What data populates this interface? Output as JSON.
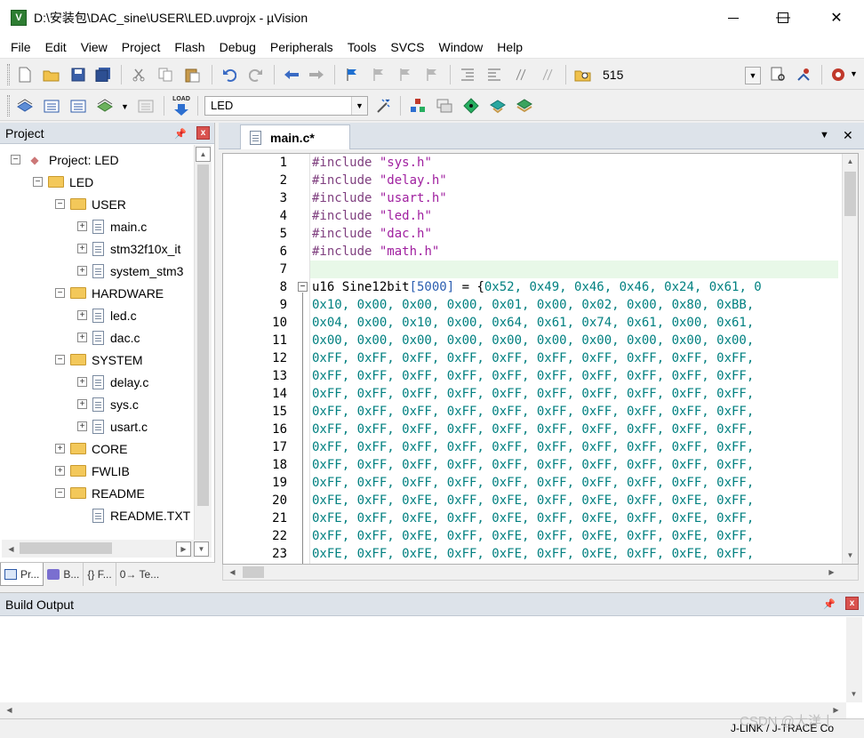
{
  "window": {
    "title": "D:\\安装包\\DAC_sine\\USER\\LED.uvprojx - µVision",
    "app_icon_glyph": "V",
    "minimize_glyph": "—",
    "maximize_glyph": "☐",
    "close_glyph": "✕"
  },
  "menu": [
    "File",
    "Edit",
    "View",
    "Project",
    "Flash",
    "Debug",
    "Peripherals",
    "Tools",
    "SVCS",
    "Window",
    "Help"
  ],
  "toolbar1": {
    "find_combo_value": "515"
  },
  "toolbar2": {
    "target_combo_value": "LED",
    "load_label": "LOAD"
  },
  "project_panel": {
    "title": "Project",
    "pin_glyph": "ᵩ",
    "close_glyph": "x",
    "tree": [
      {
        "label": "Project: LED",
        "level": 0,
        "kind": "project",
        "expander": "−"
      },
      {
        "label": "LED",
        "level": 1,
        "kind": "target",
        "expander": "−"
      },
      {
        "label": "USER",
        "level": 2,
        "kind": "folder",
        "expander": "−"
      },
      {
        "label": "main.c",
        "level": 3,
        "kind": "file",
        "expander": "+"
      },
      {
        "label": "stm32f10x_it",
        "level": 3,
        "kind": "file",
        "expander": "+"
      },
      {
        "label": "system_stm3",
        "level": 3,
        "kind": "file",
        "expander": "+"
      },
      {
        "label": "HARDWARE",
        "level": 2,
        "kind": "folder",
        "expander": "−"
      },
      {
        "label": "led.c",
        "level": 3,
        "kind": "file",
        "expander": "+"
      },
      {
        "label": "dac.c",
        "level": 3,
        "kind": "file",
        "expander": "+"
      },
      {
        "label": "SYSTEM",
        "level": 2,
        "kind": "folder",
        "expander": "−"
      },
      {
        "label": "delay.c",
        "level": 3,
        "kind": "file",
        "expander": "+"
      },
      {
        "label": "sys.c",
        "level": 3,
        "kind": "file",
        "expander": "+"
      },
      {
        "label": "usart.c",
        "level": 3,
        "kind": "file",
        "expander": "+"
      },
      {
        "label": "CORE",
        "level": 2,
        "kind": "folder",
        "expander": "+"
      },
      {
        "label": "FWLIB",
        "level": 2,
        "kind": "folder",
        "expander": "+"
      },
      {
        "label": "README",
        "level": 2,
        "kind": "folder",
        "expander": "−"
      },
      {
        "label": "README.TXT",
        "level": 3,
        "kind": "file",
        "expander": ""
      }
    ],
    "tabs": [
      {
        "label": "Pr...",
        "icon": "project-tab-icon"
      },
      {
        "label": "B...",
        "icon": "books-tab-icon"
      },
      {
        "label": "{} F...",
        "icon": "functions-tab-icon"
      },
      {
        "label": "0→ Te...",
        "icon": "templates-tab-icon"
      }
    ]
  },
  "editor": {
    "tab_label": "main.c*",
    "menu_glyph": "▼",
    "close_glyph": "✕",
    "line_numbers": [
      "1",
      "2",
      "3",
      "4",
      "5",
      "6",
      "7",
      "8",
      "9",
      "10",
      "11",
      "12",
      "13",
      "14",
      "15",
      "16",
      "17",
      "18",
      "19",
      "20",
      "21",
      "22",
      "23"
    ],
    "lines": [
      {
        "type": "include",
        "kw": "#include",
        "str": "\"sys.h\""
      },
      {
        "type": "include",
        "kw": "#include",
        "str": "\"delay.h\""
      },
      {
        "type": "include",
        "kw": "#include",
        "str": "\"usart.h\""
      },
      {
        "type": "include",
        "kw": "#include",
        "str": "\"led.h\""
      },
      {
        "type": "include",
        "kw": "#include",
        "str": "\"dac.h\""
      },
      {
        "type": "include",
        "kw": "#include",
        "str": "\"math.h\""
      },
      {
        "type": "blank"
      },
      {
        "type": "decl",
        "text": "u16 Sine12bit",
        "dim": "[5000]",
        "rest": " = {",
        "hex": "0x52, 0x49, 0x46, 0x46, 0x24, 0x61, 0"
      },
      {
        "type": "hex",
        "text": "0x10, 0x00, 0x00, 0x00, 0x01, 0x00, 0x02, 0x00, 0x80, 0xBB,"
      },
      {
        "type": "hex",
        "text": "0x04, 0x00, 0x10, 0x00, 0x64, 0x61, 0x74, 0x61, 0x00, 0x61,"
      },
      {
        "type": "hex",
        "text": "0x00, 0x00, 0x00, 0x00, 0x00, 0x00, 0x00, 0x00, 0x00, 0x00,"
      },
      {
        "type": "hex",
        "text": "0xFF, 0xFF, 0xFF, 0xFF, 0xFF, 0xFF, 0xFF, 0xFF, 0xFF, 0xFF,"
      },
      {
        "type": "hex",
        "text": "0xFF, 0xFF, 0xFF, 0xFF, 0xFF, 0xFF, 0xFF, 0xFF, 0xFF, 0xFF,"
      },
      {
        "type": "hex",
        "text": "0xFF, 0xFF, 0xFF, 0xFF, 0xFF, 0xFF, 0xFF, 0xFF, 0xFF, 0xFF,"
      },
      {
        "type": "hex",
        "text": "0xFF, 0xFF, 0xFF, 0xFF, 0xFF, 0xFF, 0xFF, 0xFF, 0xFF, 0xFF,"
      },
      {
        "type": "hex",
        "text": "0xFF, 0xFF, 0xFF, 0xFF, 0xFF, 0xFF, 0xFF, 0xFF, 0xFF, 0xFF,"
      },
      {
        "type": "hex",
        "text": "0xFF, 0xFF, 0xFF, 0xFF, 0xFF, 0xFF, 0xFF, 0xFF, 0xFF, 0xFF,"
      },
      {
        "type": "hex",
        "text": "0xFF, 0xFF, 0xFF, 0xFF, 0xFF, 0xFF, 0xFF, 0xFF, 0xFF, 0xFF,"
      },
      {
        "type": "hex",
        "text": "0xFF, 0xFF, 0xFF, 0xFF, 0xFF, 0xFF, 0xFF, 0xFF, 0xFF, 0xFF,"
      },
      {
        "type": "hex",
        "text": "0xFE, 0xFF, 0xFE, 0xFF, 0xFE, 0xFF, 0xFE, 0xFF, 0xFE, 0xFF,"
      },
      {
        "type": "hex",
        "text": "0xFE, 0xFF, 0xFE, 0xFF, 0xFE, 0xFF, 0xFE, 0xFF, 0xFE, 0xFF,"
      },
      {
        "type": "hex",
        "text": "0xFF, 0xFF, 0xFE, 0xFF, 0xFE, 0xFF, 0xFE, 0xFF, 0xFE, 0xFF,"
      },
      {
        "type": "hex",
        "text": "0xFE, 0xFF, 0xFE, 0xFF, 0xFE, 0xFF, 0xFE, 0xFF, 0xFE, 0xFF,"
      }
    ],
    "fold_marker": "−",
    "current_line_color": "#e8f8e8"
  },
  "build_output": {
    "title": "Build Output",
    "pin_glyph": "ᵩ",
    "close_glyph": "x"
  },
  "status": {
    "debugger": "J-LINK / J-TRACE Co"
  },
  "watermark": "CSDN @大洋丨",
  "colors": {
    "include_keyword": "#7f3f7f",
    "include_string": "#a020a0",
    "hex_literal": "#008080",
    "array_size": "#2a5db0"
  }
}
